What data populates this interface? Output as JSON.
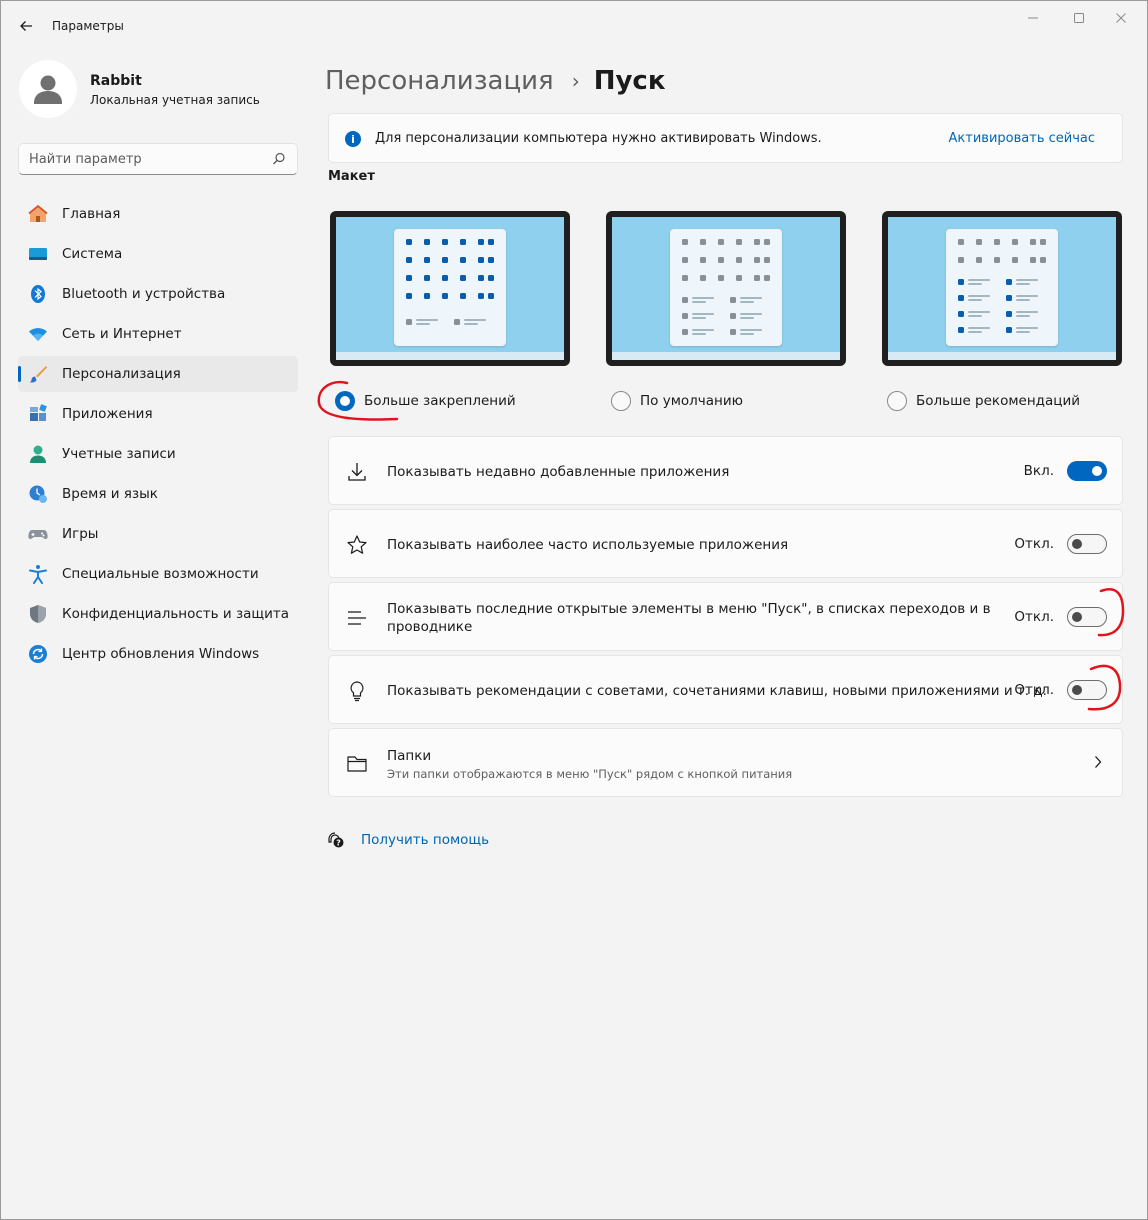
{
  "window": {
    "title": "Параметры",
    "minimize_icon": "minimize-icon",
    "maximize_icon": "maximize-icon",
    "close_icon": "close-icon"
  },
  "profile": {
    "name": "Rabbit",
    "account_type": "Локальная учетная запись"
  },
  "search": {
    "placeholder": "Найти параметр"
  },
  "sidebar": {
    "items": [
      {
        "label": "Главная",
        "icon": "home-icon"
      },
      {
        "label": "Система",
        "icon": "system-icon"
      },
      {
        "label": "Bluetooth и устройства",
        "icon": "bluetooth-icon"
      },
      {
        "label": "Сеть и Интернет",
        "icon": "wifi-icon"
      },
      {
        "label": "Персонализация",
        "icon": "brush-icon",
        "active": true
      },
      {
        "label": "Приложения",
        "icon": "apps-icon"
      },
      {
        "label": "Учетные записи",
        "icon": "accounts-icon"
      },
      {
        "label": "Время и язык",
        "icon": "time-language-icon"
      },
      {
        "label": "Игры",
        "icon": "gamepad-icon"
      },
      {
        "label": "Специальные возможности",
        "icon": "accessibility-icon"
      },
      {
        "label": "Конфиденциальность и защита",
        "icon": "shield-icon"
      },
      {
        "label": "Центр обновления Windows",
        "icon": "update-icon"
      }
    ]
  },
  "breadcrumb": {
    "parent": "Персонализация",
    "separator": "›",
    "current": "Пуск"
  },
  "activation_banner": {
    "text": "Для персонализации компьютера нужно активировать Windows.",
    "link": "Активировать сейчас",
    "icon_glyph": "i"
  },
  "layout_section": {
    "title": "Макет",
    "options": [
      {
        "label": "Больше закреплений",
        "selected": true
      },
      {
        "label": "По умолчанию",
        "selected": false
      },
      {
        "label": "Больше рекомендаций",
        "selected": false
      }
    ]
  },
  "settings": [
    {
      "text": "Показывать недавно добавленные приложения",
      "state": "Вкл.",
      "on": true,
      "icon": "download-icon"
    },
    {
      "text": "Показывать наиболее часто используемые приложения",
      "state": "Откл.",
      "on": false,
      "icon": "star-icon"
    },
    {
      "text_line1": "Показывать последние открытые элементы в меню \"Пуск\", в списках переходов и в",
      "text_line2": "проводнике",
      "state": "Откл.",
      "on": false,
      "icon": "list-icon"
    },
    {
      "text": "Показывать рекомендации с советами, сочетаниями клавиш, новыми приложениями и т. д.",
      "state": "Откл.",
      "on": false,
      "icon": "lightbulb-icon"
    }
  ],
  "folders": {
    "title": "Папки",
    "subtitle": "Эти папки отображаются в меню \"Пуск\" рядом с кнопкой питания",
    "icon": "folder-icon"
  },
  "help": {
    "label": "Получить помощь",
    "icon": "help-icon"
  },
  "colors": {
    "accent": "#0067c0",
    "link": "#0066b4",
    "annotation": "#e0141e"
  }
}
